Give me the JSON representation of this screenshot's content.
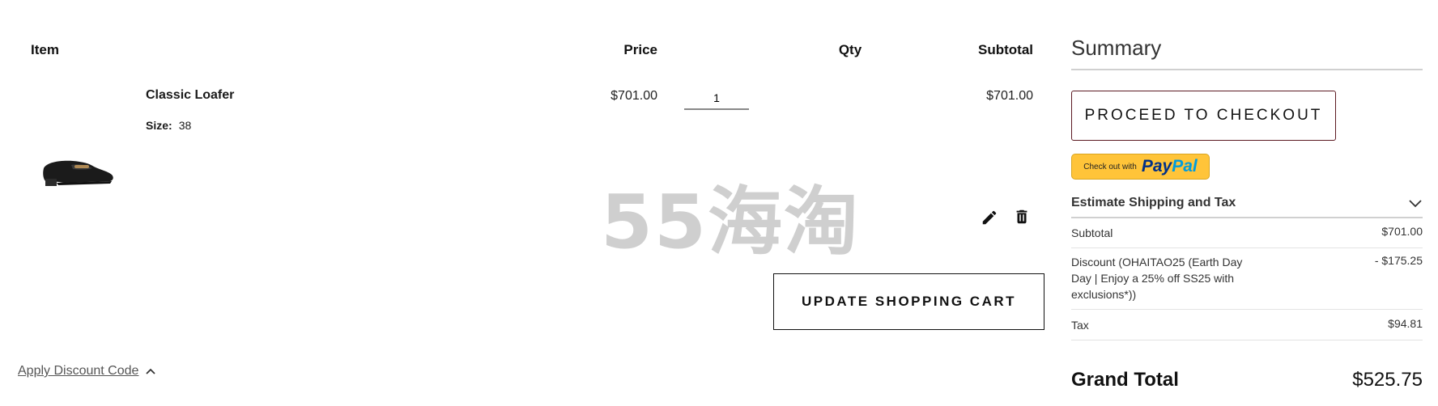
{
  "cart": {
    "headers": {
      "item": "Item",
      "price": "Price",
      "qty": "Qty",
      "subtotal": "Subtotal"
    },
    "items": [
      {
        "name": "Classic Loafer",
        "size_label": "Size:",
        "size_value": "38",
        "price": "$701.00",
        "qty": "1",
        "subtotal": "$701.00",
        "image_icon": "loafer-shoe-image"
      }
    ],
    "actions": {
      "edit_icon": "pencil-icon",
      "delete_icon": "trash-icon"
    },
    "update_button": "UPDATE SHOPPING CART",
    "discount_link": "Apply Discount Code",
    "watermark": "55海淘"
  },
  "summary": {
    "title": "Summary",
    "checkout_button": "PROCEED TO CHECKOUT",
    "paypal": {
      "small": "Check out with",
      "brand_a": "Pay",
      "brand_b": "Pal"
    },
    "estimate": "Estimate Shipping and Tax",
    "rows": [
      {
        "label": "Subtotal",
        "value": "$701.00"
      },
      {
        "label": "Discount (OHAITAO25 (Earth Day Day | Enjoy a 25% off SS25 with exclusions*))",
        "value": "- $175.25"
      },
      {
        "label": "Tax",
        "value": "$94.81"
      }
    ],
    "grand_total": {
      "label": "Grand Total",
      "value": "$525.75"
    }
  },
  "colors": {
    "checkout_border": "#5c1a22",
    "paypal_bg": "#ffc439",
    "paypal_dark": "#003087",
    "paypal_light": "#009cde",
    "watermark": "#cfcfcf"
  }
}
